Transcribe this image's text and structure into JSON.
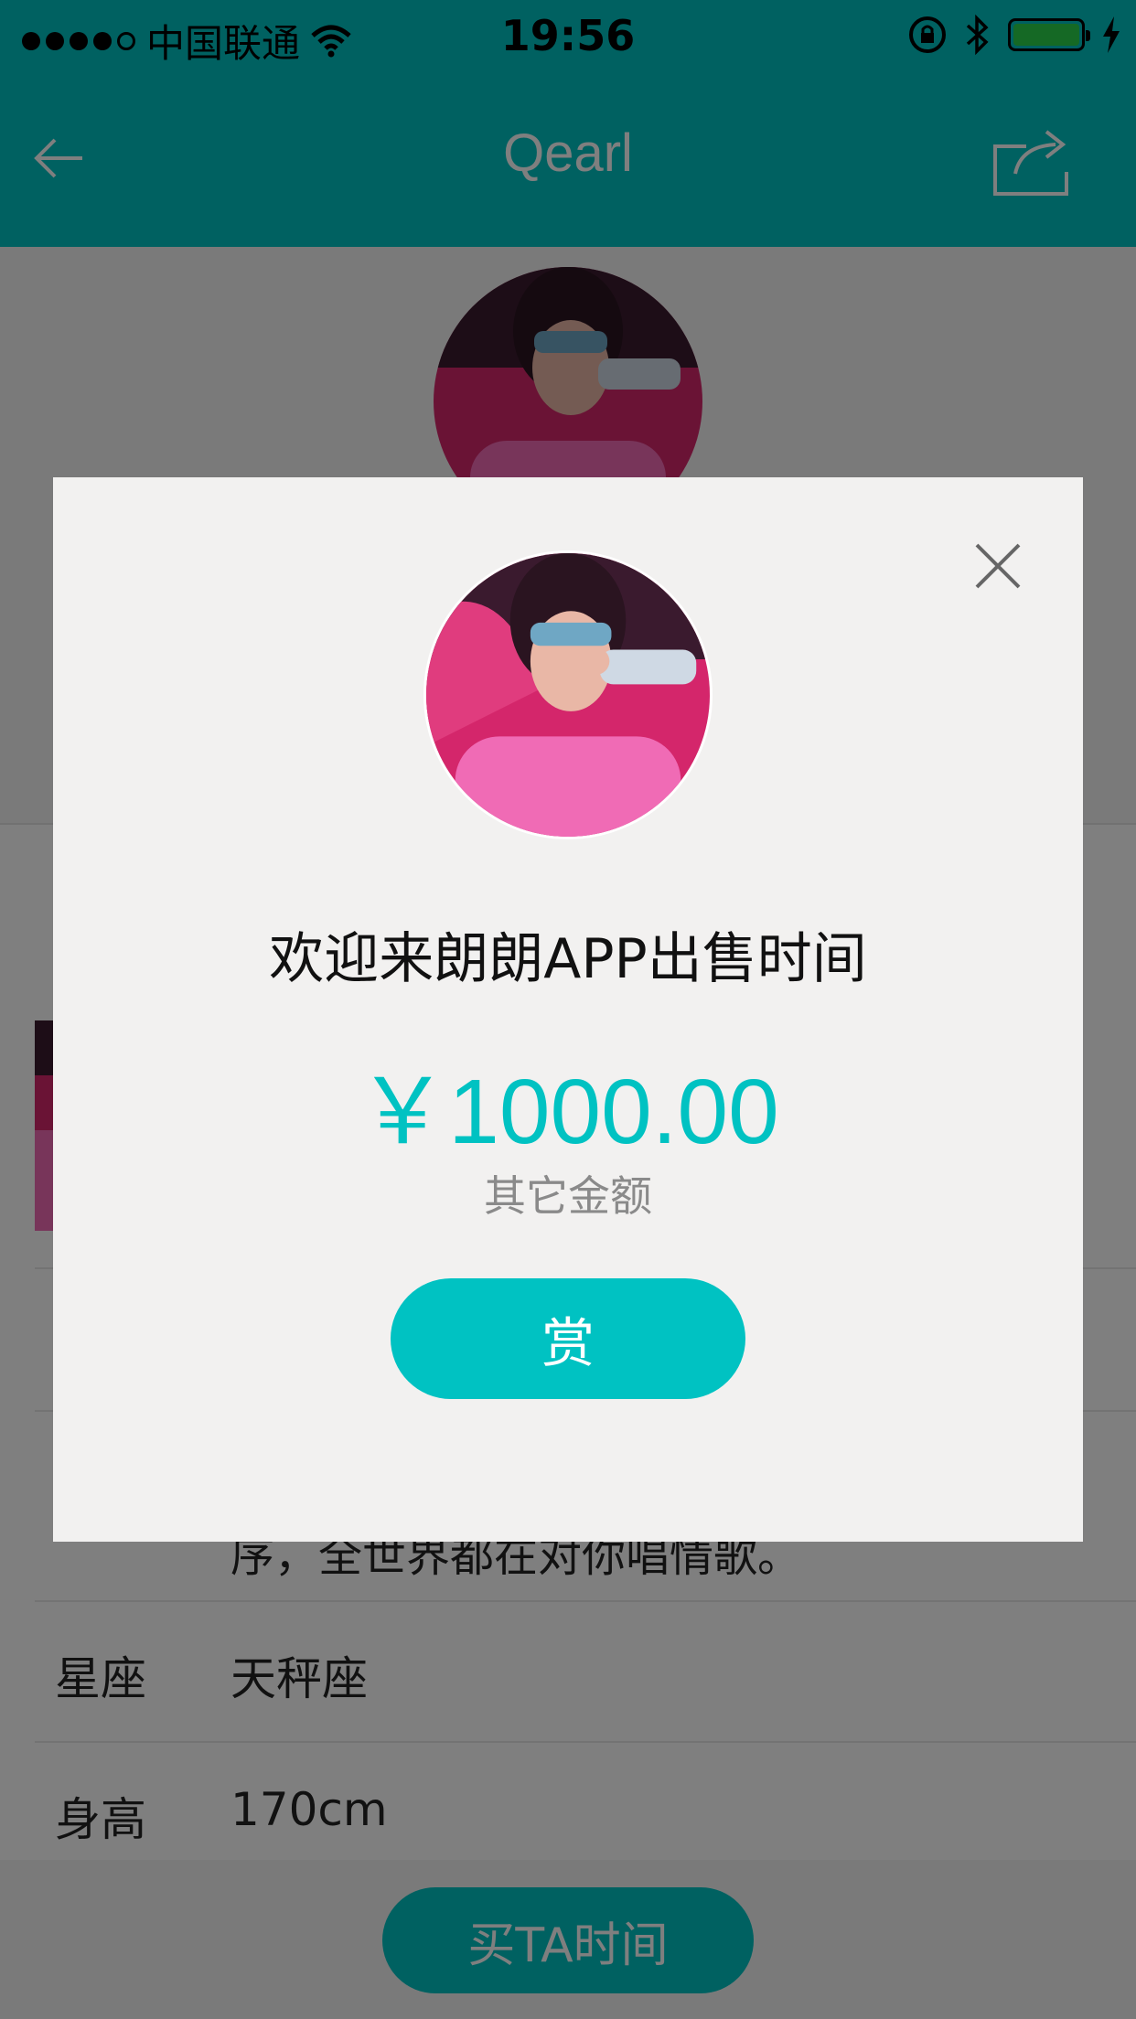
{
  "status_bar": {
    "carrier": "中国联通",
    "time": "19:56"
  },
  "nav": {
    "title": "Qearl"
  },
  "profile": {
    "rows": [
      {
        "label": "星座",
        "value": "天秤座"
      },
      {
        "label": "身高",
        "value": "170cm"
      }
    ],
    "partial_text": "序，全世界都在对你唱情歌。",
    "buy_button": "买TA时间"
  },
  "modal": {
    "title": "欢迎来朗朗APP出售时间",
    "amount": "￥1000.00",
    "other_amount": "其它金额",
    "reward_button": "赏"
  },
  "colors": {
    "accent": "#00c2c2",
    "overlay": "rgba(0,0,0,0.5)",
    "modal_bg": "#f2f1f0"
  },
  "icons": {
    "back": "back-arrow-icon",
    "share": "share-icon",
    "close": "close-icon",
    "wifi": "wifi-icon",
    "lock": "orientation-lock-icon",
    "bluetooth": "bluetooth-icon",
    "charging": "charging-bolt-icon"
  }
}
